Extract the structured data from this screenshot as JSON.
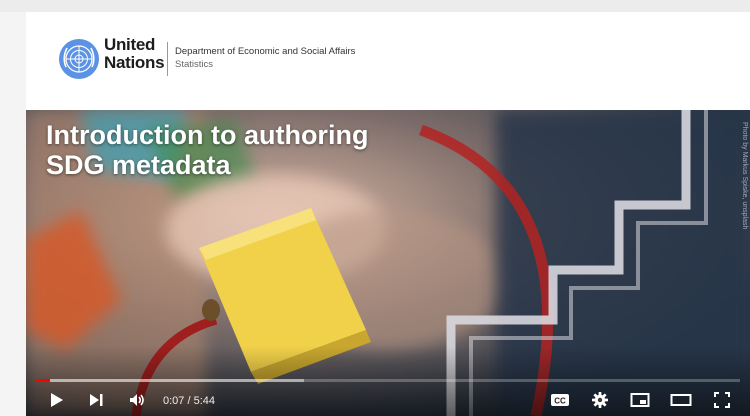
{
  "header": {
    "org_line1": "United",
    "org_line2": "Nations",
    "department": "Department of Economic and Social Affairs",
    "division": "Statistics"
  },
  "video": {
    "title_line1": "Introduction to authoring",
    "title_line2": "SDG metadata",
    "photo_credit": "Photo by Markus Spiske, unsplash",
    "current_time": "0:07",
    "duration": "5:44",
    "time_display": "0:07 / 5:44",
    "played_fraction": 0.02,
    "loaded_fraction": 0.38,
    "progress_color": "#ff0000"
  },
  "controls": {
    "play": "play-icon",
    "next": "next-icon",
    "volume": "volume-icon",
    "captions": "CC",
    "settings": "gear-icon",
    "miniplayer": "miniplayer-icon",
    "theater": "theater-icon",
    "fullscreen": "fullscreen-icon"
  }
}
